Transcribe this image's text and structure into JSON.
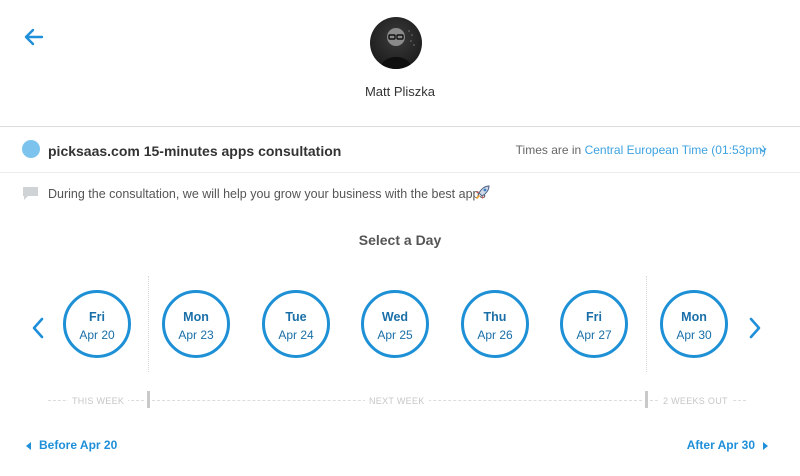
{
  "header": {
    "back_icon": "arrow-left-icon",
    "avatar_icon": "person-portrait",
    "host_name": "Matt Pliszka"
  },
  "event": {
    "color": "#7cc4ee",
    "title": "picksaas.com 15-minutes apps consultation",
    "timezone_prefix": "Times are in ",
    "timezone_label": "Central European Time (01:53pm)",
    "timezone_icon": "chevron-down-icon",
    "description_icon": "speech-bubble-icon",
    "description": "During the consultation, we will help you grow your business with the best apps",
    "description_emoji": "rocket-icon"
  },
  "calendar": {
    "title": "Select a Day",
    "prev_icon": "chevron-left-icon",
    "next_icon": "chevron-right-icon",
    "accent": "#1e90d6",
    "days": [
      {
        "name": "Fri",
        "date": "Apr 20"
      },
      {
        "name": "Mon",
        "date": "Apr 23"
      },
      {
        "name": "Tue",
        "date": "Apr 24"
      },
      {
        "name": "Wed",
        "date": "Apr 25"
      },
      {
        "name": "Thu",
        "date": "Apr 26"
      },
      {
        "name": "Fri",
        "date": "Apr 27"
      },
      {
        "name": "Mon",
        "date": "Apr 30"
      }
    ],
    "week_labels": {
      "this_week": "THIS WEEK",
      "next_week": "NEXT WEEK",
      "two_weeks_out": "2 WEEKS OUT"
    },
    "before_link": "Before Apr 20",
    "after_link": "After Apr 30"
  }
}
